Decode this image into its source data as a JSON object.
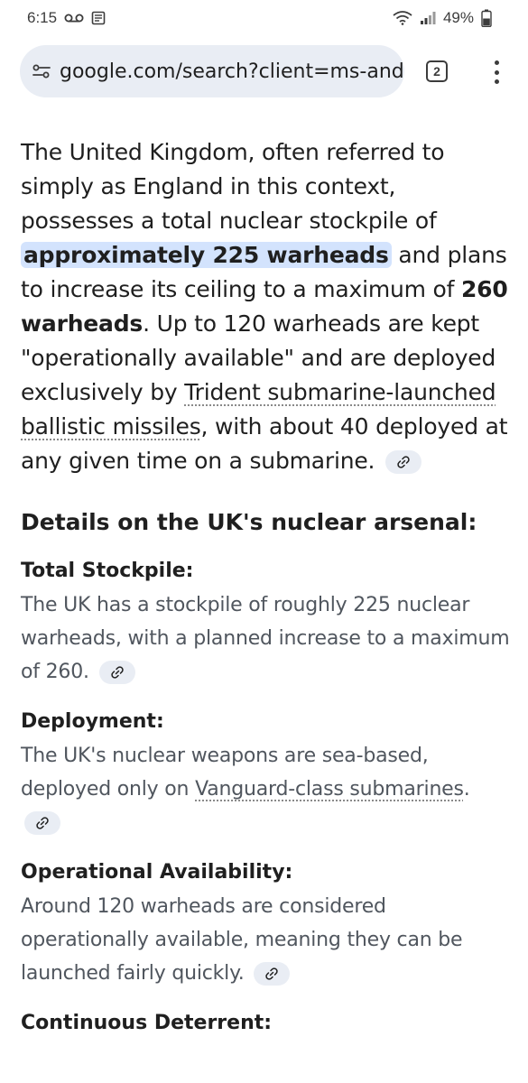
{
  "status_bar": {
    "time": "6:15",
    "battery": "49%"
  },
  "browser": {
    "url": "google.com/search?client=ms-andr",
    "tab_count": "2"
  },
  "answer": {
    "p1": "The United Kingdom, often referred to simply as England in this context, possesses a total nuclear stockpile of ",
    "highlight": "approximately 225 warheads",
    "p2": " and plans to increase its ceiling to a maximum of ",
    "bold": "260 warheads",
    "p3": ". Up to 120 warheads are kept \"operationally available\" and are deployed exclusively by ",
    "link": "Trident submarine-launched ballistic missiles",
    "p4": ", with about 40 deployed at any given time on a submarine."
  },
  "section_title": "Details on the UK's nuclear arsenal:",
  "items": [
    {
      "title": "Total Stockpile:",
      "body": "The UK has a stockpile of roughly 225 nuclear warheads, with a planned increase to a maximum of 260."
    },
    {
      "title": "Deployment:",
      "body_pre": "The UK's nuclear weapons are sea-based, deployed only on ",
      "body_link": "Vanguard-class submarines",
      "body_post": "."
    },
    {
      "title": "Operational Availability:",
      "body": "Around 120 warheads are considered operationally available, meaning they can be launched fairly quickly."
    },
    {
      "title": "Continuous Deterrent:"
    }
  ]
}
